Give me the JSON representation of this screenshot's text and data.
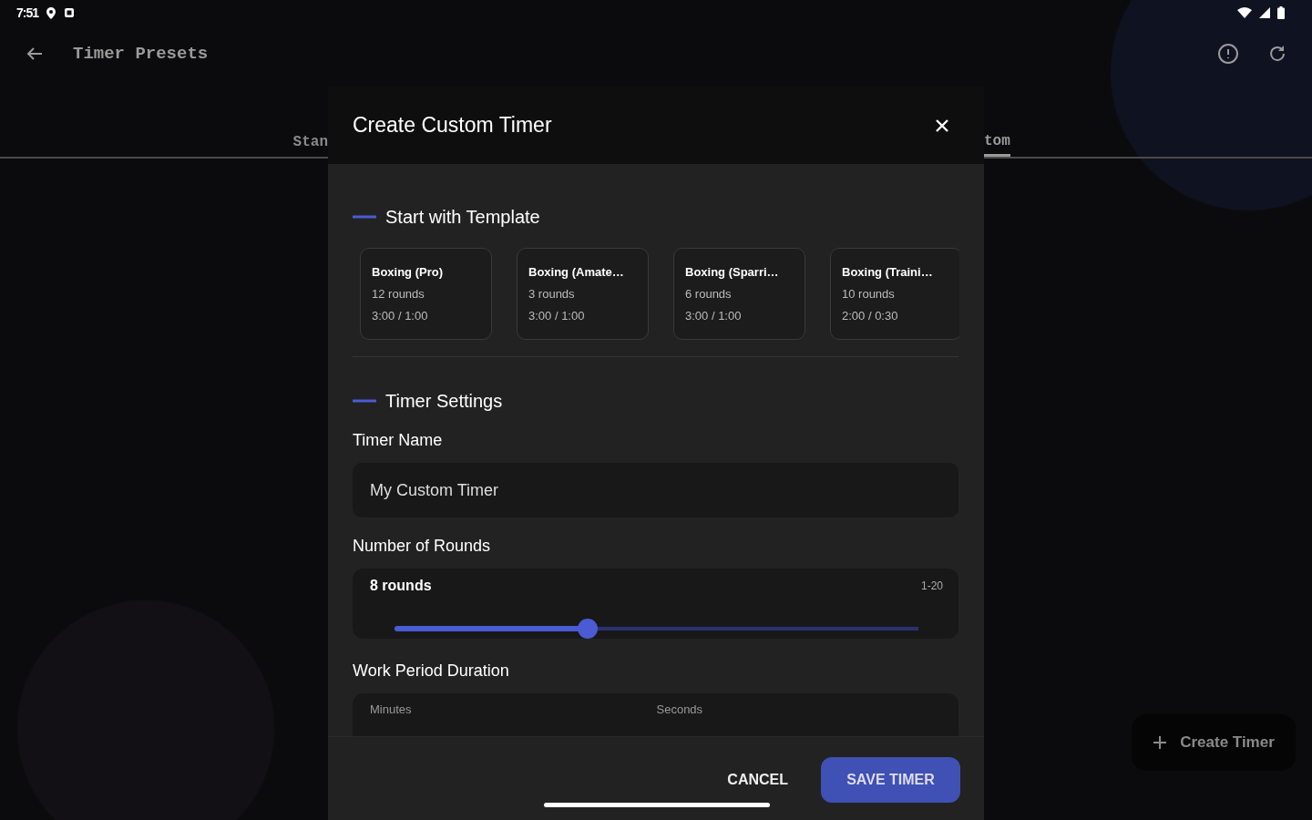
{
  "status_bar": {
    "time": "7:51"
  },
  "app_bar": {
    "title": "Timer Presets"
  },
  "tabs": [
    {
      "label": "Stan",
      "selected": false
    },
    {
      "label": "tom",
      "selected": true
    }
  ],
  "fab": {
    "label": "Create Timer"
  },
  "dialog": {
    "title": "Create Custom Timer",
    "template_section": {
      "title": "Start with Template",
      "templates": [
        {
          "name": "Boxing (Pro)",
          "rounds": "12 rounds",
          "times": "3:00 / 1:00"
        },
        {
          "name": "Boxing (Amate…",
          "rounds": "3 rounds",
          "times": "3:00 / 1:00"
        },
        {
          "name": "Boxing (Sparri…",
          "rounds": "6 rounds",
          "times": "3:00 / 1:00"
        },
        {
          "name": "Boxing (Traini…",
          "rounds": "10 rounds",
          "times": "2:00 / 0:30"
        }
      ]
    },
    "settings_section": {
      "title": "Timer Settings",
      "fields": [
        {
          "kind": "text",
          "label": "Timer Name",
          "value": "My Custom Timer"
        },
        {
          "kind": "slider",
          "label": "Number of Rounds",
          "reading": "8 rounds",
          "range": "1-20",
          "level": 0.368
        },
        {
          "kind": "duration",
          "label": "Work Period Duration",
          "parts": [
            "Minutes",
            "Seconds"
          ]
        }
      ]
    },
    "buttons": [
      {
        "kind": "text",
        "label": "CANCEL"
      },
      {
        "kind": "filled",
        "label": "SAVE TIMER"
      }
    ]
  }
}
